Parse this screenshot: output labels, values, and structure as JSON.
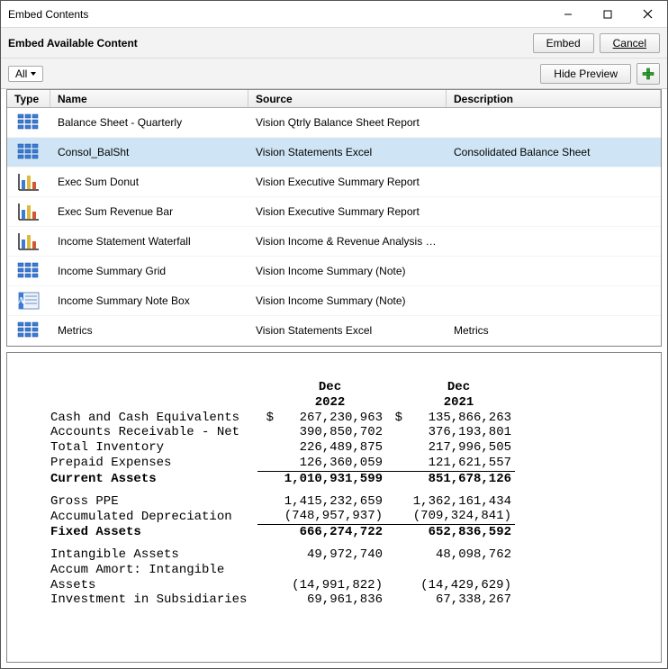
{
  "window": {
    "title": "Embed Contents"
  },
  "toolbar": {
    "heading": "Embed Available Content",
    "embed": "Embed",
    "cancel": "Cancel",
    "filter": "All",
    "hide_preview": "Hide Preview"
  },
  "columns": {
    "type": "Type",
    "name": "Name",
    "source": "Source",
    "desc": "Description"
  },
  "rows": [
    {
      "icon": "grid",
      "name": "Balance Sheet - Quarterly",
      "source": "Vision Qtrly Balance Sheet Report",
      "desc": "",
      "selected": false
    },
    {
      "icon": "grid",
      "name": "Consol_BalSht",
      "source": "Vision Statements Excel",
      "desc": "Consolidated Balance Sheet",
      "selected": true
    },
    {
      "icon": "bar",
      "name": "Exec Sum Donut",
      "source": "Vision Executive Summary Report",
      "desc": "",
      "selected": false
    },
    {
      "icon": "bar",
      "name": "Exec Sum Revenue Bar",
      "source": "Vision Executive Summary Report",
      "desc": "",
      "selected": false
    },
    {
      "icon": "bar",
      "name": "Income Statement Waterfall",
      "source": "Vision Income & Revenue Analysis Report",
      "desc": "",
      "selected": false
    },
    {
      "icon": "grid",
      "name": "Income Summary Grid",
      "source": "Vision Income Summary (Note)",
      "desc": "",
      "selected": false
    },
    {
      "icon": "note",
      "name": "Income Summary Note Box",
      "source": "Vision Income Summary (Note)",
      "desc": "",
      "selected": false
    },
    {
      "icon": "grid",
      "name": "Metrics",
      "source": "Vision Statements Excel",
      "desc": "Metrics",
      "selected": false
    }
  ],
  "preview": {
    "headers": {
      "col1": "Dec 2022",
      "col2": "Dec 2021",
      "col1a": "Dec",
      "col1b": "2022",
      "col2a": "Dec",
      "col2b": "2021"
    },
    "currency": "$",
    "lines": [
      {
        "label": "Cash and Cash Equivalents",
        "v1": "267,230,963",
        "v2": "135,866,263",
        "showcur": true
      },
      {
        "label": "Accounts Receivable - Net",
        "v1": "390,850,702",
        "v2": "376,193,801"
      },
      {
        "label": "Total Inventory",
        "v1": "226,489,875",
        "v2": "217,996,505"
      },
      {
        "label": "Prepaid Expenses",
        "v1": "126,360,059",
        "v2": "121,621,557"
      },
      {
        "label": "Current Assets",
        "v1": "1,010,931,599",
        "v2": "851,678,126",
        "bold": true,
        "topline": true
      },
      {
        "spacer": true
      },
      {
        "label": "Gross PPE",
        "v1": "1,415,232,659",
        "v2": "1,362,161,434"
      },
      {
        "label": "Accumulated Depreciation",
        "v1": "(748,957,937)",
        "v2": "(709,324,841)"
      },
      {
        "label": "Fixed Assets",
        "v1": "666,274,722",
        "v2": "652,836,592",
        "bold": true,
        "topline": true
      },
      {
        "spacer": true
      },
      {
        "label": "Intangible Assets",
        "v1": "49,972,740",
        "v2": "48,098,762"
      },
      {
        "label": "Accum Amort: Intangible Assets",
        "v1": "(14,991,822)",
        "v2": "(14,429,629)",
        "wrap": true,
        "label1": "Accum Amort: Intangible",
        "label2": "Assets"
      },
      {
        "label": "Investment in Subsidiaries",
        "v1": "69,961,836",
        "v2": "67,338,267"
      }
    ]
  }
}
